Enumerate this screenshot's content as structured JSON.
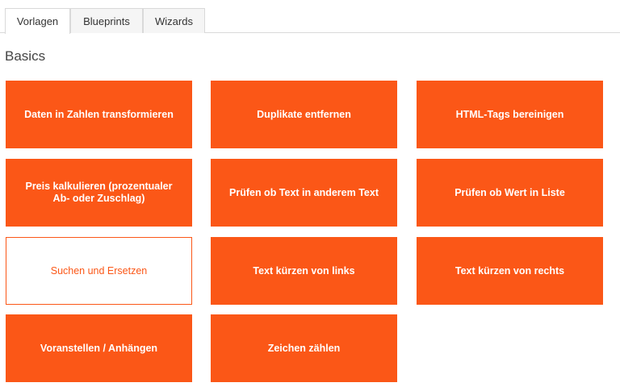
{
  "tabs": [
    {
      "label": "Vorlagen",
      "active": true
    },
    {
      "label": "Blueprints",
      "active": false
    },
    {
      "label": "Wizards",
      "active": false
    }
  ],
  "section": {
    "title": "Basics"
  },
  "cards": [
    {
      "label": "Daten in Zahlen transformieren"
    },
    {
      "label": "Duplikate entfernen"
    },
    {
      "label": "HTML-Tags bereinigen"
    },
    {
      "label": "Preis kalkulieren (prozentualer Ab- oder Zuschlag)"
    },
    {
      "label": "Prüfen ob Text in anderem Text"
    },
    {
      "label": "Prüfen ob Wert in Liste"
    },
    {
      "label": "Suchen und Ersetzen"
    },
    {
      "label": "Text kürzen von links"
    },
    {
      "label": "Text kürzen von rechts"
    },
    {
      "label": "Voranstellen / Anhängen"
    },
    {
      "label": "Zeichen zählen"
    }
  ],
  "colors": {
    "accent": "#fb5717",
    "card_text": "#ffffff"
  }
}
